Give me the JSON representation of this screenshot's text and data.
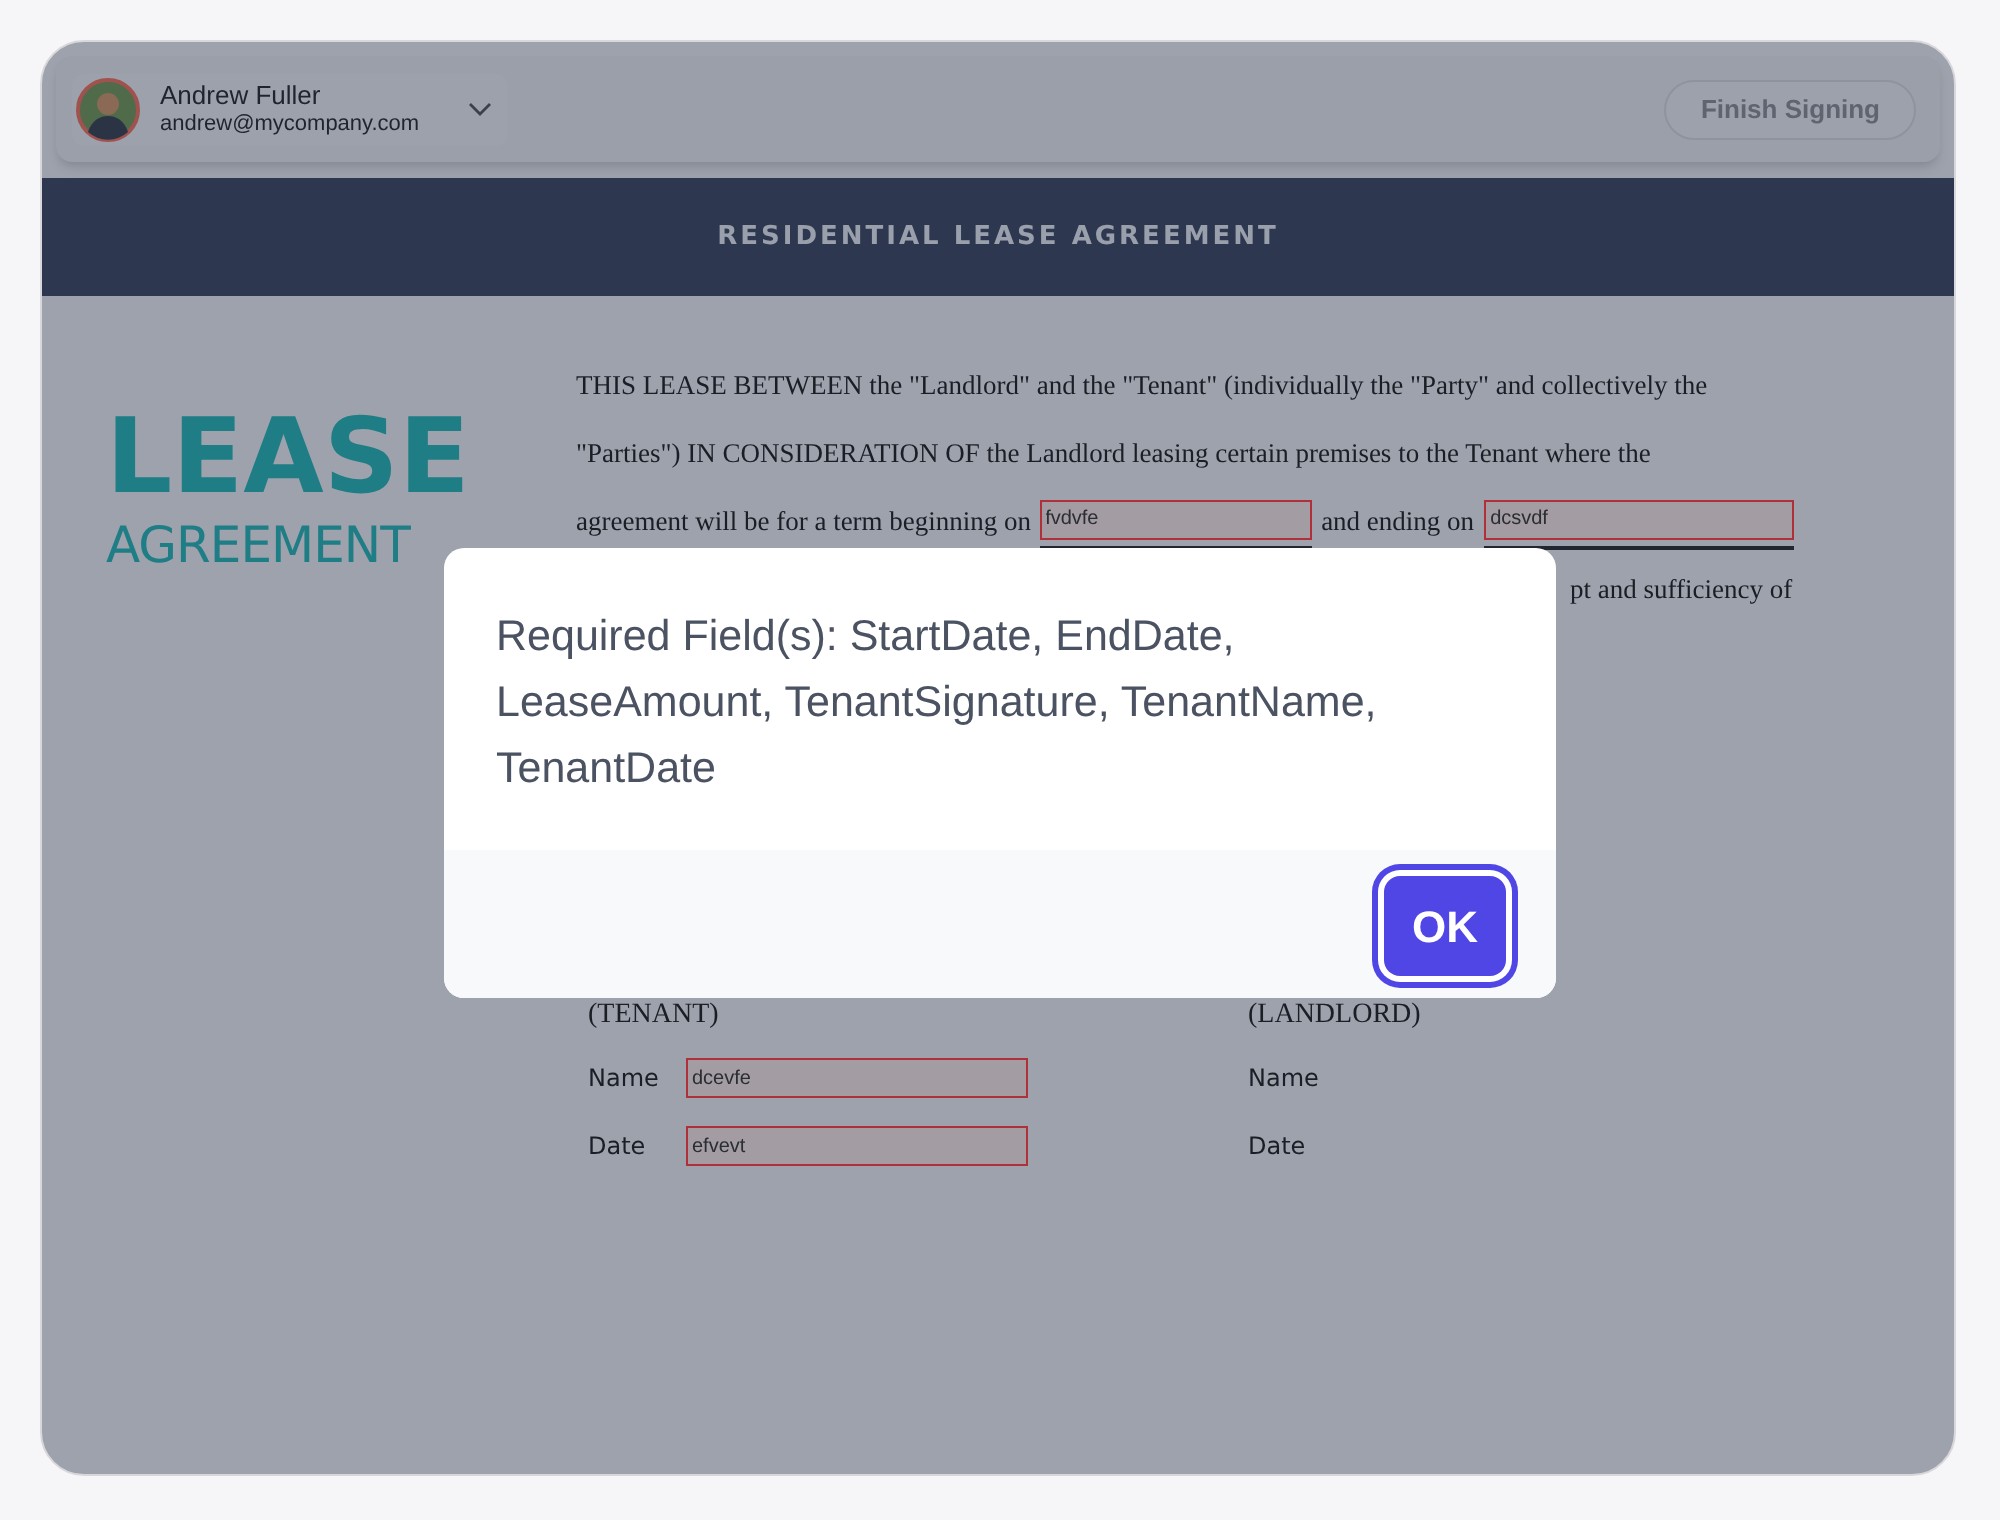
{
  "header": {
    "user": {
      "name": "Andrew Fuller",
      "email": "andrew@mycompany.com"
    },
    "finish_button": {
      "label": "Finish Signing",
      "disabled": true
    }
  },
  "banner": {
    "title": "RESIDENTIAL LEASE AGREEMENT"
  },
  "logo": {
    "line_1": "LEASE",
    "line_2": "AGREEMENT"
  },
  "body": {
    "line_1": "THIS LEASE BETWEEN the \"Landlord\" and the \"Tenant\" (individually the \"Party\" and collectively the",
    "line_2": "\"Parties\") IN CONSIDERATION OF the Landlord leasing certain premises to the Tenant where the",
    "line_3": {
      "before": "agreement will be for a term beginning on",
      "start_field": {
        "value": "fvdvfe",
        "invalid": true
      },
      "middle": "and ending on",
      "end_field": {
        "value": "dcsvdf",
        "invalid": true
      }
    },
    "line_4_fragment": "pt and sufficiency of"
  },
  "parties": [
    {
      "heading": "(TENANT)",
      "fields": [
        {
          "label": "Name",
          "value": "dcevfe",
          "invalid": true
        },
        {
          "label": "Date",
          "value": "efvevt",
          "invalid": true
        }
      ]
    },
    {
      "heading": "(LANDLORD)",
      "fields": [
        {
          "label": "Name"
        },
        {
          "label": "Date"
        }
      ]
    }
  ],
  "dialog": {
    "message": "Required Field(s): StartDate, EndDate, LeaseAmount, TenantSignature, TenantName, TenantDate",
    "ok_label": "OK"
  }
}
